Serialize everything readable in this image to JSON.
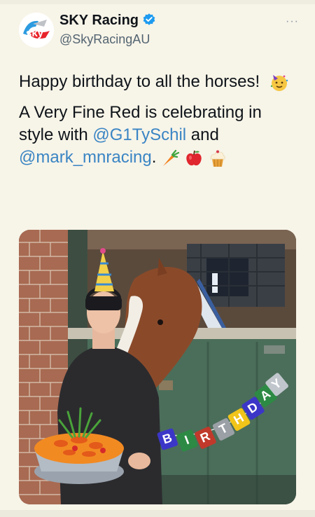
{
  "tweet": {
    "display_name": "SKY Racing",
    "handle": "@SkyRacingAU",
    "more_label": "···",
    "text_line1": "Happy birthday to all the horses!",
    "text_line2_a": "A Very Fine Red is celebrating in style with ",
    "mention_1": "@G1TySchil",
    "text_and": " and ",
    "mention_2": "@mark_mnracing",
    "text_period": ".",
    "emojis": [
      "partying-face",
      "carrot",
      "red-apple",
      "cupcake"
    ]
  },
  "media": {
    "banner_letters": [
      "B",
      "I",
      "R",
      "T",
      "H",
      "D",
      "A",
      "Y"
    ],
    "banner_colors": [
      "#3b36c8",
      "#2d8a44",
      "#c0392b",
      "#9aa0a6",
      "#f0c419",
      "#3b36c8",
      "#2d8a44",
      "#c0c6cc"
    ]
  },
  "colors": {
    "accent": "#1d9bf0",
    "mention": "#3a85c4",
    "background": "#f7f4e8"
  }
}
